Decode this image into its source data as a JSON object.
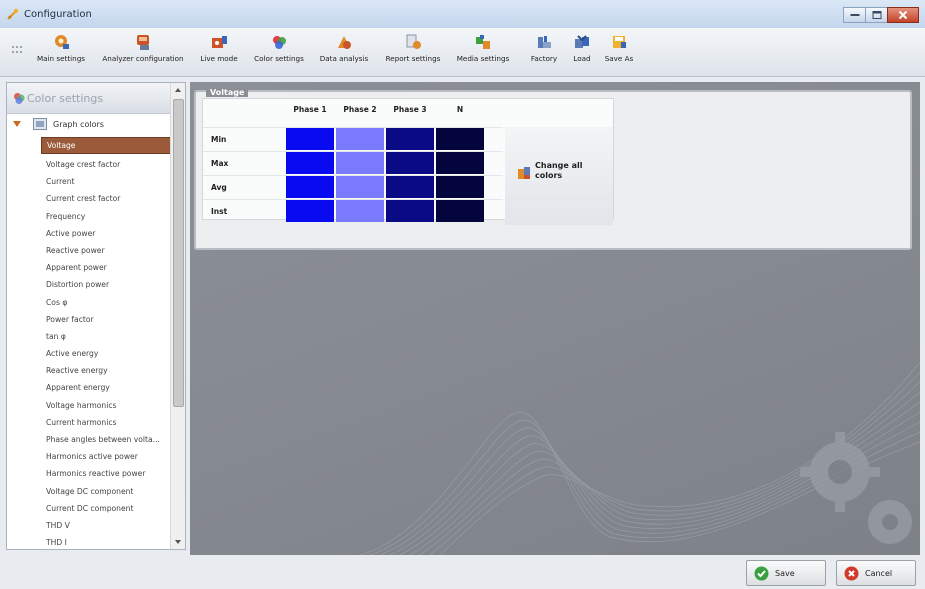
{
  "window": {
    "title": "Configuration"
  },
  "toolbar": {
    "items": [
      {
        "label": "Main settings"
      },
      {
        "label": "Analyzer configuration"
      },
      {
        "label": "Live mode"
      },
      {
        "label": "Color settings"
      },
      {
        "label": "Data analysis"
      },
      {
        "label": "Report settings"
      },
      {
        "label": "Media settings"
      },
      {
        "label": "Factory"
      },
      {
        "label": "Load"
      },
      {
        "label": "Save As"
      }
    ]
  },
  "sidebar": {
    "header": "Color settings",
    "root": "Graph colors",
    "items": [
      {
        "label": "Voltage",
        "selected": true
      },
      {
        "label": "Voltage crest factor"
      },
      {
        "label": "Current"
      },
      {
        "label": "Current crest factor"
      },
      {
        "label": "Frequency"
      },
      {
        "label": "Active power"
      },
      {
        "label": "Reactive power"
      },
      {
        "label": "Apparent power"
      },
      {
        "label": "Distortion power"
      },
      {
        "label": "Cos φ"
      },
      {
        "label": "Power factor"
      },
      {
        "label": "tan φ"
      },
      {
        "label": "Active energy"
      },
      {
        "label": "Reactive energy"
      },
      {
        "label": "Apparent energy"
      },
      {
        "label": "Voltage harmonics"
      },
      {
        "label": "Current harmonics"
      },
      {
        "label": "Phase angles between volta..."
      },
      {
        "label": "Harmonics active power"
      },
      {
        "label": "Harmonics reactive power"
      },
      {
        "label": "Voltage DC component"
      },
      {
        "label": "Current DC component"
      },
      {
        "label": "THD V"
      },
      {
        "label": "THD I"
      }
    ]
  },
  "panel": {
    "group_title": "Voltage",
    "columns": [
      "Phase 1",
      "Phase 2",
      "Phase 3",
      "N"
    ],
    "rows": [
      {
        "label": "Min",
        "colors": [
          "#0a0af0",
          "#7a7aff",
          "#0a0a86",
          "#05053e"
        ]
      },
      {
        "label": "Max",
        "colors": [
          "#0a0af0",
          "#7a7aff",
          "#0a0a86",
          "#05053e"
        ]
      },
      {
        "label": "Avg",
        "colors": [
          "#0a0af0",
          "#7a7aff",
          "#0a0a86",
          "#05053e"
        ]
      },
      {
        "label": "Inst",
        "colors": [
          "#0a0af0",
          "#7a7aff",
          "#0a0a86",
          "#05053e"
        ]
      }
    ],
    "change_all": "Change all colors"
  },
  "buttons": {
    "save": "Save",
    "cancel": "Cancel"
  },
  "colors": {
    "selected_item": "#9b5a3a",
    "main_bg": "#868b91"
  }
}
